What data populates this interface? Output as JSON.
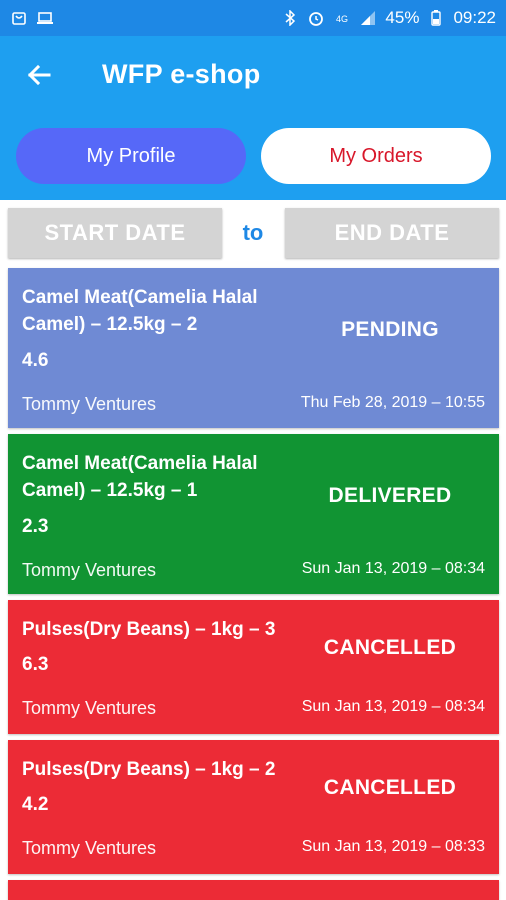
{
  "status_bar": {
    "battery": "45%",
    "time": "09:22",
    "left_icons": [
      "shop-icon",
      "laptop-icon"
    ],
    "right_icons": [
      "bluetooth-icon",
      "alarm-icon",
      "4g-icon",
      "signal-icon",
      "battery-icon"
    ]
  },
  "app_bar": {
    "title": "WFP e-shop",
    "back_icon": "arrow-left-icon"
  },
  "tabs": {
    "profile": "My Profile",
    "orders": "My Orders"
  },
  "date_filter": {
    "start": "START DATE",
    "separator": "to",
    "end": "END DATE"
  },
  "orders": [
    {
      "product": "Camel Meat(Camelia Halal Camel) – 12.5kg – 2",
      "amount": "4.6",
      "status": "PENDING",
      "vendor": "Tommy Ventures",
      "date": "Thu Feb 28, 2019 – 10:55"
    },
    {
      "product": "Camel Meat(Camelia Halal Camel) – 12.5kg – 1",
      "amount": "2.3",
      "status": "DELIVERED",
      "vendor": "Tommy Ventures",
      "date": "Sun Jan 13, 2019 – 08:34"
    },
    {
      "product": "Pulses(Dry Beans) – 1kg – 3",
      "amount": "6.3",
      "status": "CANCELLED",
      "vendor": "Tommy Ventures",
      "date": "Sun Jan 13, 2019 – 08:34"
    },
    {
      "product": "Pulses(Dry Beans) – 1kg – 2",
      "amount": "4.2",
      "status": "CANCELLED",
      "vendor": "Tommy Ventures",
      "date": "Sun Jan 13, 2019 – 08:33"
    }
  ],
  "colors": {
    "status_bar": "#1e88e5",
    "app_bar": "#1e9ff0",
    "tab_active": "#5668f8",
    "tab_orders_text": "#d8172a",
    "pending": "#6f8ad4",
    "delivered": "#119433",
    "cancelled": "#ec2b36",
    "date_button": "#d4d4d4"
  }
}
